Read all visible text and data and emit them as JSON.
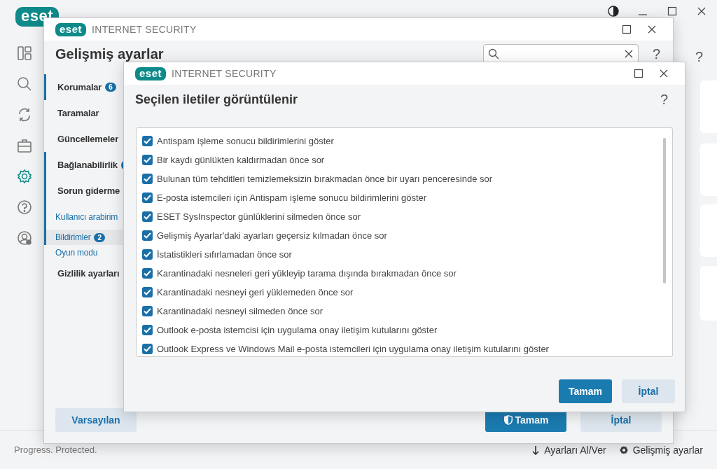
{
  "app": {
    "logo": "eset",
    "help": "?",
    "status": "Progress. Protected.",
    "nav": [
      {
        "kind": "dashboard",
        "selected": false
      },
      {
        "kind": "search",
        "selected": false
      },
      {
        "kind": "refresh",
        "selected": false
      },
      {
        "kind": "briefcase",
        "selected": false
      },
      {
        "kind": "gear",
        "selected": true
      },
      {
        "kind": "help",
        "selected": false
      },
      {
        "kind": "account",
        "selected": false
      }
    ],
    "footer_links": [
      {
        "label": "Ayarları Al/Ver",
        "kind": "transfer"
      },
      {
        "label": "Gelişmiş ayarlar",
        "kind": "gear"
      }
    ]
  },
  "settings_window": {
    "logo": "eset",
    "product": "INTERNET SECURITY",
    "title": "Gelişmiş ayarlar",
    "help": "?",
    "nav": [
      {
        "label": "Korumalar",
        "badge": "6",
        "modified": true,
        "selected": false
      },
      {
        "label": "Taramalar",
        "modified": false,
        "selected": false
      },
      {
        "label": "Güncellemeler",
        "modified": false,
        "selected": false
      },
      {
        "label": "Bağlanabilirlik",
        "badge_covered": true,
        "modified": true,
        "selected": false
      },
      {
        "label": "Sorun giderme",
        "modified": true,
        "selected": false
      },
      {
        "label": "Kullanıcı arabirim",
        "modified": true,
        "selected": false,
        "expanded": true,
        "children": [
          {
            "label": "Bildirimler",
            "badge": "2",
            "modified": true,
            "selected": true
          },
          {
            "label": "Oyun modu",
            "modified": false,
            "selected": false
          }
        ]
      },
      {
        "label": "Gizlilik ayarları",
        "modified": false,
        "selected": false
      }
    ],
    "buttons": [
      {
        "label": "Varsayılan",
        "kind": "secondary"
      },
      {
        "label": "Tamam",
        "kind": "primary"
      },
      {
        "label": "İptal",
        "kind": "secondary"
      }
    ]
  },
  "dialog": {
    "logo": "eset",
    "product": "INTERNET SECURITY",
    "title": "Seçilen iletiler görüntülenir",
    "help": "?",
    "items": [
      {
        "label": "Antispam işleme sonucu bildirimlerini göster",
        "checked": true
      },
      {
        "label": "Bir kaydı günlükten kaldırmadan önce sor",
        "checked": true
      },
      {
        "label": "Bulunan tüm tehditleri temizlemeksizin bırakmadan önce bir uyarı penceresinde sor",
        "checked": true
      },
      {
        "label": "E-posta istemcileri için Antispam işleme sonucu bildirimlerini göster",
        "checked": true
      },
      {
        "label": "ESET SysInspector günlüklerini silmeden önce sor",
        "checked": true
      },
      {
        "label": "Gelişmiş Ayarlar'daki ayarları geçersiz kılmadan önce sor",
        "checked": true
      },
      {
        "label": "İstatistikleri sıfırlamadan önce sor",
        "checked": true
      },
      {
        "label": "Karantinadaki nesneleri geri yükleyip tarama dışında bırakmadan önce sor",
        "checked": true
      },
      {
        "label": "Karantinadaki nesneyi geri yüklemeden önce sor",
        "checked": true
      },
      {
        "label": "Karantinadaki nesneyi silmeden önce sor",
        "checked": true
      },
      {
        "label": "Outlook e-posta istemcisi için uygulama onay iletişim kutularını göster",
        "checked": true
      },
      {
        "label": "Outlook Express ve Windows Mail e-posta istemcileri için uygulama onay iletişim kutularını göster",
        "checked": true
      }
    ],
    "buttons": [
      {
        "label": "Tamam",
        "kind": "primary"
      },
      {
        "label": "İptal",
        "kind": "secondary"
      }
    ]
  }
}
